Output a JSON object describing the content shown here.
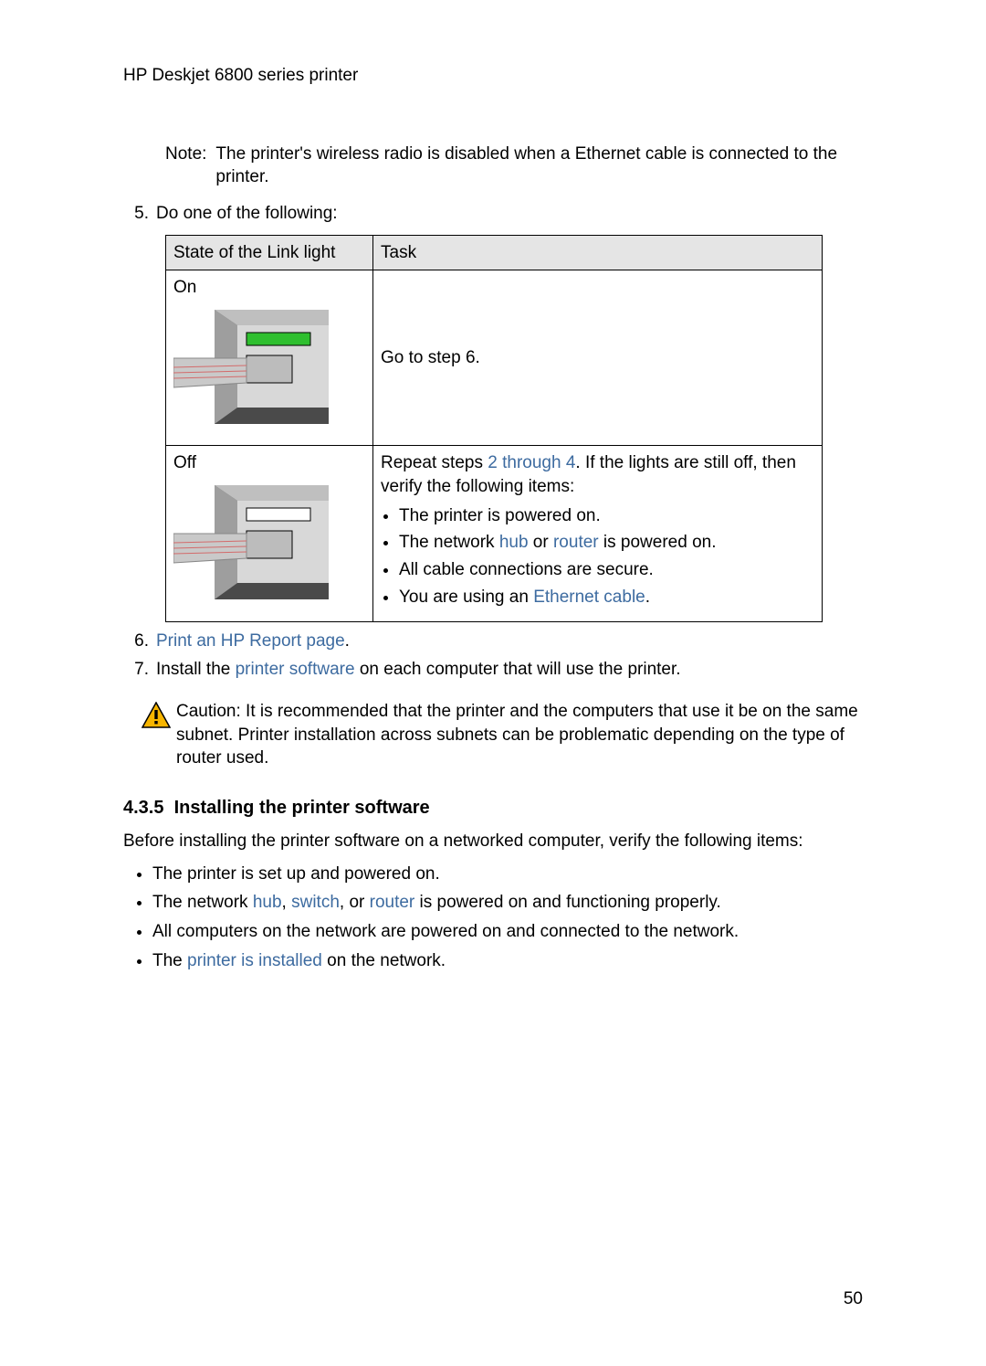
{
  "header": {
    "title": "HP Deskjet 6800 series printer"
  },
  "note": {
    "label": "Note:",
    "text": "The printer's wireless radio is disabled when a Ethernet cable is connected to the printer."
  },
  "steps": {
    "s5": {
      "num": "5.",
      "text": "Do one of the following:"
    },
    "s6": {
      "num": "6.",
      "link": "Print an HP Report page",
      "tail": "."
    },
    "s7": {
      "num": "7.",
      "lead": "Install the ",
      "link": "printer software",
      "tail": " on each computer that will use the printer."
    }
  },
  "table": {
    "headers": {
      "state": "State of the Link light",
      "task": "Task"
    },
    "rows": {
      "on": {
        "state": "On",
        "task": "Go to step 6."
      },
      "off": {
        "state": "Off",
        "lead": "Repeat steps ",
        "link1": "2 through 4",
        "mid": ". If the lights are still off, then verify the following items:",
        "bullets": {
          "b1": "The printer is powered on.",
          "b2_a": "The network ",
          "b2_link1": "hub",
          "b2_b": " or ",
          "b2_link2": "router",
          "b2_c": " is powered on.",
          "b3": "All cable connections are secure.",
          "b4_a": "You are using an ",
          "b4_link": "Ethernet cable",
          "b4_b": "."
        }
      }
    }
  },
  "caution": {
    "label": "Caution:",
    "text": " It is recommended that the printer and the computers that use it be on the same subnet. Printer installation across subnets can be problematic depending on the type of router used."
  },
  "section": {
    "number": "4.3.5",
    "title": "Installing the printer software"
  },
  "intro": "Before installing the printer software on a networked computer, verify the following items:",
  "verify": {
    "v1": "The printer is set up and powered on.",
    "v2_a": "The network ",
    "v2_l1": "hub",
    "v2_b": ", ",
    "v2_l2": "switch",
    "v2_c": ", or ",
    "v2_l3": "router",
    "v2_d": " is powered on and functioning properly.",
    "v3": "All computers on the network are powered on and connected to the network.",
    "v4_a": "The ",
    "v4_l": "printer is installed",
    "v4_b": " on the network."
  },
  "pageNumber": "50"
}
